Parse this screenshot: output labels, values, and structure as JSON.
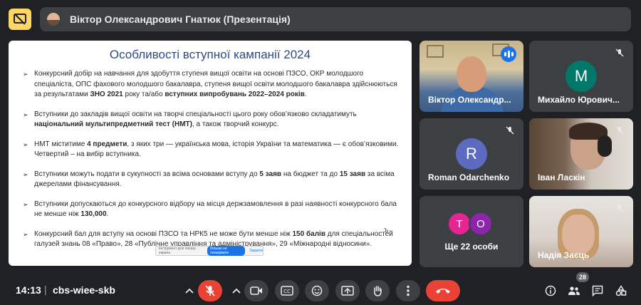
{
  "presenter": {
    "name": "Віктор Олександрович Гнатюк (Презентація)",
    "stop_present_icon": "present-to-all-off-icon"
  },
  "slide": {
    "title": "Особливості вступної кампанії  2024",
    "bullets": [
      {
        "segments": [
          {
            "text": "Конкурсний добір на навчання для здобуття ступеня вищої освіти на основі ПЗСО, ОКР молодшого спеціаліста, ОПС фахового молодшого бакалавра, ступеня вищої освіти молодшого бакалавра здійснюються за результатами ",
            "bold": false
          },
          {
            "text": "ЗНО 2021",
            "bold": true
          },
          {
            "text": " року та/або ",
            "bold": false
          },
          {
            "text": "вступних випробувань 2022–2024 років",
            "bold": true
          },
          {
            "text": ".",
            "bold": false
          }
        ]
      },
      {
        "segments": [
          {
            "text": "Вступники до закладів вищої освіти на творчі спеціальності цього року обов’язково складатимуть ",
            "bold": false
          },
          {
            "text": "національний мультипредметний тест (НМТ)",
            "bold": true
          },
          {
            "text": ", а також творчий конкурс.",
            "bold": false
          }
        ]
      },
      {
        "segments": [
          {
            "text": "НМТ міститиме ",
            "bold": false
          },
          {
            "text": "4 предмети",
            "bold": true
          },
          {
            "text": ", з яких три — українська мова, історія України та математика — є обов’язковими. Четвертий – на вибір вступника.",
            "bold": false
          }
        ]
      },
      {
        "segments": [
          {
            "text": "Вступники  можуть подати в сукупності за всіма основами вступу до ",
            "bold": false
          },
          {
            "text": "5 заяв",
            "bold": true
          },
          {
            "text": " на бюджет та до ",
            "bold": false
          },
          {
            "text": "15 заяв",
            "bold": true
          },
          {
            "text": " за всіма джерелами фінансування.",
            "bold": false
          }
        ]
      },
      {
        "segments": [
          {
            "text": "Вступники допускаються до конкурсного відбору на місця держзамовлення в разі наявності конкурсного бала не менше ніж ",
            "bold": false
          },
          {
            "text": "130,000",
            "bold": true
          },
          {
            "text": ".",
            "bold": false
          }
        ]
      },
      {
        "segments": [
          {
            "text": "Конкурсний бал для вступу на основі ПЗСО та НРК5 не може бути менше ніж ",
            "bold": false
          },
          {
            "text": "150 балів",
            "bold": true
          },
          {
            "text": " для спеціальностей галузей знань 08 «Право», 28 «Публічне управління та адміністрування», 29 «Міжнародні відносини».",
            "bold": false
          }
        ]
      }
    ],
    "bullet_glyph": "➢",
    "overlay": {
      "text": "Інструмент для показу екрана",
      "button": "Більше не показувати",
      "close": "Закрити"
    },
    "cursor_glyph": "Ъ"
  },
  "participants": [
    {
      "name": "Віктор Олександр...",
      "state": "speaking",
      "kind": "video"
    },
    {
      "name": "Михайло Юрович...",
      "state": "muted",
      "kind": "avatar",
      "initial": "M",
      "color": "#00796b"
    },
    {
      "name": "Roman Odarchenko",
      "state": "muted",
      "kind": "avatar",
      "initial": "R",
      "color": "#5c6bc0"
    },
    {
      "name": "Іван Ласкін",
      "state": "muted",
      "kind": "video"
    },
    {
      "name": "Ще 22 особи",
      "kind": "overflow",
      "avatars": [
        {
          "initial": "T",
          "color": "#e52592"
        },
        {
          "initial": "O",
          "color": "#8e24aa"
        }
      ]
    },
    {
      "name": "Надія Заєць",
      "state": "muted",
      "kind": "video"
    }
  ],
  "bottom_bar": {
    "time": "14:13",
    "separator": "|",
    "meeting_code": "cbs-wiee-skb",
    "participant_count": "28",
    "controls": [
      "chevron-up-icon",
      "mic-off-icon",
      "chevron-up-icon",
      "camera-icon",
      "captions-icon",
      "emoji-icon",
      "present-icon",
      "raise-hand-icon",
      "more-vert-icon",
      "hang-up-icon"
    ],
    "right_icons": [
      "info-icon",
      "people-icon",
      "chat-icon",
      "activities-icon"
    ],
    "accent_colors": {
      "hangup": "#ea4335",
      "mic_off": "#ea4335",
      "speaking": "#1a73e8"
    }
  }
}
